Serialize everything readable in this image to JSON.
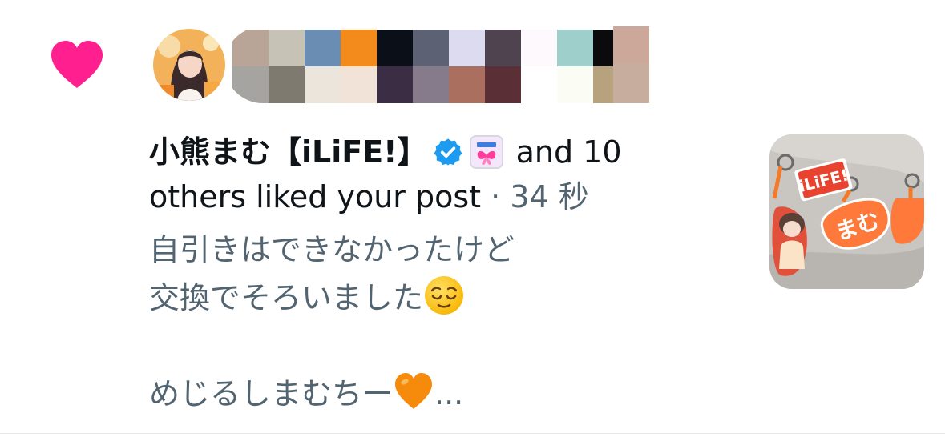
{
  "notification": {
    "type_icon": "heart-icon",
    "sender": {
      "name": "小熊まむ【iLiFE!】",
      "verified_icon": "verified-badge-icon",
      "affiliation_badge": "iLiFE-affiliation-badge"
    },
    "summary_rest": " and 10 others liked your post",
    "separator": " · ",
    "time": "34 秒",
    "post": {
      "line1": "自引きはできなかったけど",
      "line2": "交換でそろいました",
      "line2_emoji": "relieved-face-emoji",
      "line3": "めじるしまむちー",
      "line3_emoji": "orange-heart-icon",
      "ellipsis": "..."
    },
    "thumbnail": {
      "label_1": "iLiFE!",
      "label_2": "まむ"
    }
  },
  "colors": {
    "like_heart": "#ff1f8e",
    "primary_text": "#0f1419",
    "secondary_text": "#536471",
    "verified": "#1d9bf0",
    "divider": "#e6e9eb"
  }
}
